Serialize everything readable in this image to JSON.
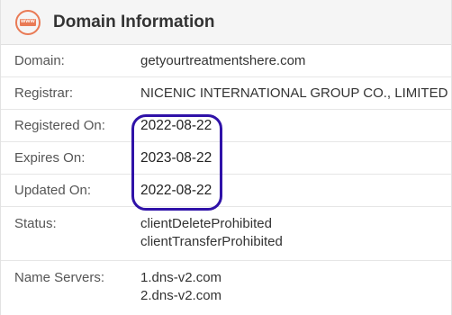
{
  "header": {
    "icon": "www-globe-icon",
    "icon_text": "www",
    "title": "Domain Information"
  },
  "rows": {
    "domain": {
      "label": "Domain:",
      "value": "getyourtreatmentshere.com"
    },
    "registrar": {
      "label": "Registrar:",
      "value": "NICENIC INTERNATIONAL GROUP CO., LIMITED"
    },
    "registered_on": {
      "label": "Registered On:",
      "value": "2022-08-22"
    },
    "expires_on": {
      "label": "Expires On:",
      "value": "2023-08-22"
    },
    "updated_on": {
      "label": "Updated On:",
      "value": "2022-08-22"
    },
    "status": {
      "label": "Status:",
      "values": [
        "clientDeleteProhibited",
        "clientTransferProhibited"
      ]
    },
    "name_servers": {
      "label": "Name Servers:",
      "values": [
        "1.dns-v2.com",
        "2.dns-v2.com"
      ]
    }
  },
  "colors": {
    "icon_accent": "#e97a55",
    "highlight_outline": "#2f12a8",
    "header_bg": "#f5f5f5"
  }
}
